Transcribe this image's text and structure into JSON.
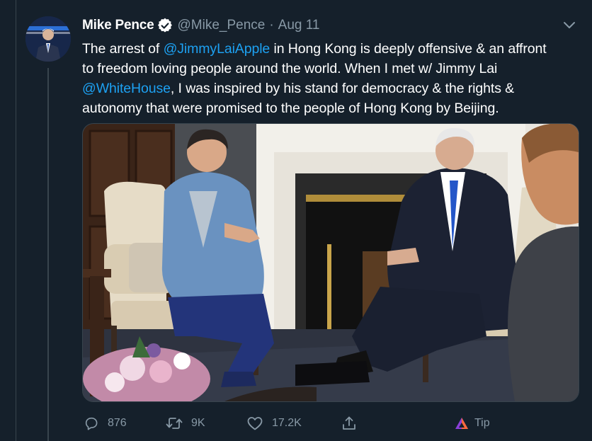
{
  "tweet": {
    "author": {
      "display_name": "Mike Pence",
      "handle": "@Mike_Pence",
      "verified": true,
      "avatar_icon": "profile-photo"
    },
    "separator": "·",
    "date": "Aug 11",
    "text_segments": [
      {
        "text": "The arrest of ",
        "type": "text"
      },
      {
        "text": "@JimmyLaiApple",
        "type": "mention"
      },
      {
        "text": " in Hong Kong is deeply offensive & an affront to freedom loving people around the world. When I met w/ Jimmy Lai ",
        "type": "text"
      },
      {
        "text": "@WhiteHouse",
        "type": "mention"
      },
      {
        "text": ", I was inspired by his stand for democracy & the rights & autonomy that were promised to the people of Hong Kong by Beijing.",
        "type": "text"
      }
    ],
    "lines": {
      "l1_a": "The arrest of ",
      "l1_mention": "@JimmyLaiApple",
      "l1_b": " in Hong Kong is deeply offensive & an affront",
      "l2": "to freedom loving people around the world. When I met w/ Jimmy Lai",
      "l3_mention": "@WhiteHouse",
      "l3_b": ", I was inspired by his stand for democracy & the rights &",
      "l4": "autonomy that were promised to the people of Hong Kong by Beijing."
    },
    "media": {
      "type": "photo"
    },
    "actions": {
      "reply_count": "876",
      "retweet_count": "9K",
      "like_count": "17.2K",
      "tip_label": "Tip"
    }
  },
  "colors": {
    "background": "#15202b",
    "text": "#ffffff",
    "secondary_text": "#8899a6",
    "link": "#1da1f2",
    "border": "#38444d",
    "verified_badge": "#ffffff"
  },
  "icons": {
    "more": "chevron-down-icon",
    "reply": "reply-icon",
    "retweet": "retweet-icon",
    "like": "heart-icon",
    "share": "share-icon",
    "tip": "tip-icon",
    "verified": "verified-badge-icon"
  }
}
